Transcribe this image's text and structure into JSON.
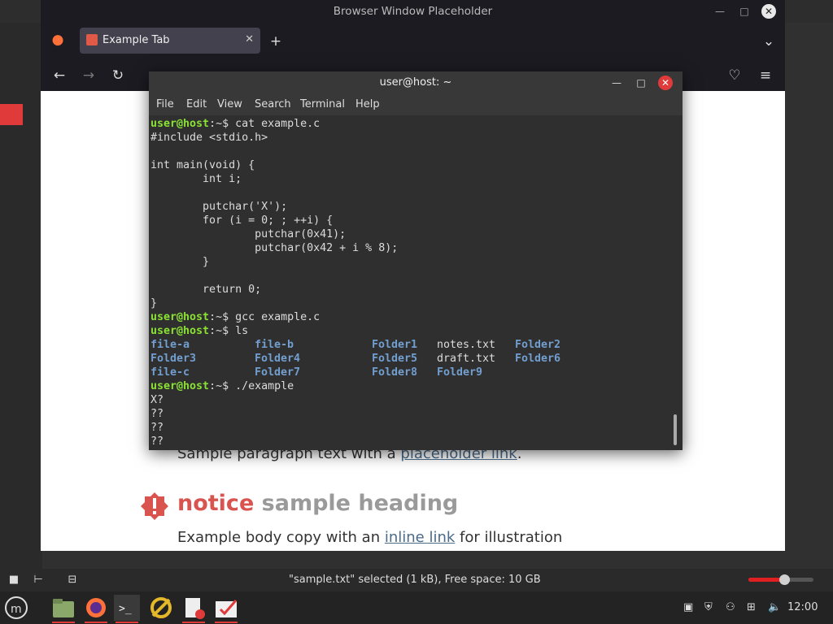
{
  "firefox": {
    "window_title": "Browser Window Placeholder",
    "tab_title": "Example Tab",
    "page": {
      "line1_prefix": "Sample paragraph text with a ",
      "line1_link": "placeholder link",
      "line1_suffix": ".",
      "announcement_word": "notice",
      "announcement_rest": " sample heading",
      "line2_prefix": "Example body copy with an ",
      "line2_link": "inline link",
      "line2_suffix": " for illustration"
    }
  },
  "terminal": {
    "title": "user@host: ~",
    "menu": [
      "File",
      "Edit",
      "View",
      "Search",
      "Terminal",
      "Help"
    ],
    "prompt": "user@host",
    "lines": [
      {
        "prompt": true,
        "cmd": "cat example.c"
      },
      {
        "text": "#include <stdio.h>"
      },
      {
        "text": ""
      },
      {
        "text": "int main(void) {"
      },
      {
        "text": "        int i;"
      },
      {
        "text": ""
      },
      {
        "text": "        putchar('X');"
      },
      {
        "text": "        for (i = 0; ; ++i) {"
      },
      {
        "text": "                putchar(0x41);"
      },
      {
        "text": "                putchar(0x42 + i % 8);"
      },
      {
        "text": "        }"
      },
      {
        "text": ""
      },
      {
        "text": "        return 0;"
      },
      {
        "text": "}"
      },
      {
        "prompt": true,
        "cmd": "gcc example.c"
      },
      {
        "prompt": true,
        "cmd": "ls"
      }
    ],
    "ls_rows": [
      [
        "file-a",
        "file-b",
        "Folder1",
        "notes.txt",
        "Folder2"
      ],
      [
        "Folder3",
        "Folder4",
        "Folder5",
        "draft.txt",
        "Folder6"
      ],
      [
        "file-c",
        "Folder7",
        "Folder8",
        "Folder9",
        ""
      ]
    ],
    "last_cmd": "./example",
    "output": [
      "X?",
      "??",
      "??",
      "??"
    ]
  },
  "filemanager": {
    "status": "\"sample.txt\" selected (1 kB), Free space: 10 GB",
    "zoom_level": 0.55
  },
  "taskbar": {
    "clock": "12:00",
    "apps": [
      "menu-icon",
      "files-icon",
      "browser-icon",
      "terminal-icon",
      "sync-icon",
      "editor-icon",
      "notes-icon"
    ]
  }
}
